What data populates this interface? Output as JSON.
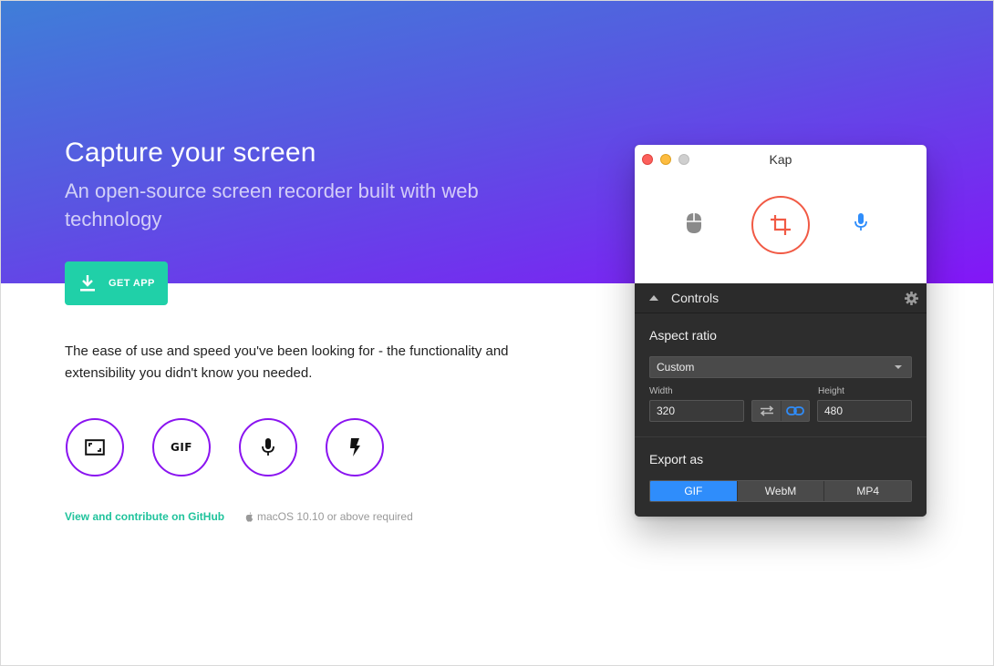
{
  "hero": {
    "headline": "Capture your screen",
    "subhead": "An open-source screen recorder built with web technology",
    "get_app_label": "GET APP"
  },
  "tagline": "The ease of use and speed you've been looking for - the functionality and extensibility you didn't know you needed.",
  "features": [
    {
      "icon": "aspect-ratio-icon"
    },
    {
      "icon": "gif-icon",
      "label": "GIF"
    },
    {
      "icon": "microphone-icon"
    },
    {
      "icon": "lightning-icon"
    }
  ],
  "footer": {
    "github_link": "View and contribute on GitHub",
    "requirement": "macOS 10.10 or above required"
  },
  "kap": {
    "title": "Kap",
    "controls_label": "Controls",
    "aspect_ratio_label": "Aspect ratio",
    "aspect_ratio_value": "Custom",
    "width_label": "Width",
    "width_value": "320",
    "height_label": "Height",
    "height_value": "480",
    "export_label": "Export as",
    "export_options": [
      "GIF",
      "WebM",
      "MP4"
    ],
    "export_selected": "GIF"
  },
  "colors": {
    "accent_green": "#20d0a8",
    "accent_purple": "#8a14f0",
    "crop_red": "#f15a45",
    "export_blue": "#2f8dfb"
  }
}
